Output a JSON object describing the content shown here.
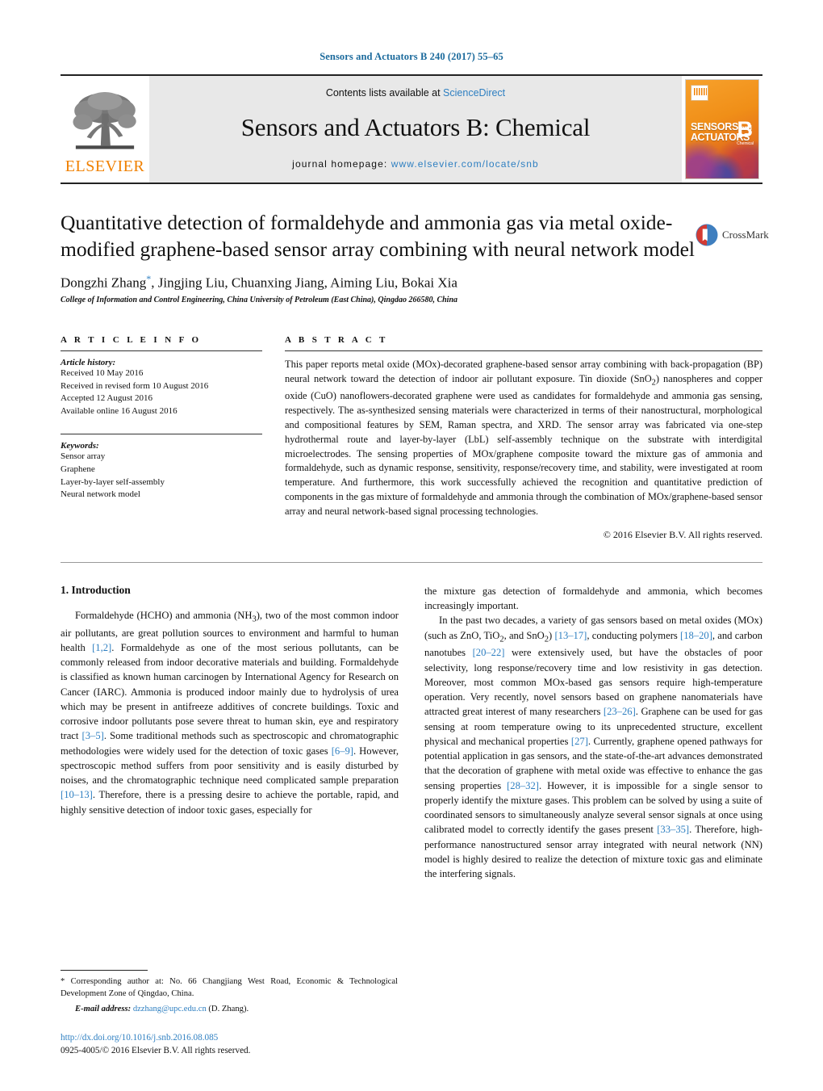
{
  "running_head": "Sensors and Actuators B 240 (2017) 55–65",
  "masthead": {
    "contents_prefix": "Contents lists available at ",
    "contents_link": "ScienceDirect",
    "journal_name": "Sensors and Actuators B: Chemical",
    "homepage_label": "journal homepage: ",
    "homepage_url": "www.elsevier.com/locate/snb",
    "publisher_wordmark": "ELSEVIER",
    "publisher_logo_icon": "elsevier-tree-icon",
    "cover": {
      "line1": "SENSORS",
      "line1_small": "and",
      "line2": "ACTUATORS",
      "letter": "B",
      "sublabel": "Chemical"
    }
  },
  "article": {
    "title": "Quantitative detection of formaldehyde and ammonia gas via metal oxide-modified graphene-based sensor array combining with neural network model",
    "authors": "Dongzhi Zhang",
    "authors_rest": ", Jingjing Liu, Chuanxing Jiang, Aiming Liu, Bokai Xia",
    "corresponding_marker": "*",
    "affiliation": "College of Information and Control Engineering, China University of Petroleum (East China), Qingdao 266580, China",
    "crossmark_label": "CrossMark",
    "crossmark_icon": "crossmark-icon"
  },
  "article_info": {
    "heading": "A R T I C L E   I N F O",
    "history_title": "Article history:",
    "history": [
      "Received 10 May 2016",
      "Received in revised form 10 August 2016",
      "Accepted 12 August 2016",
      "Available online 16 August 2016"
    ],
    "keywords_title": "Keywords:",
    "keywords": [
      "Sensor array",
      "Graphene",
      "Layer-by-layer self-assembly",
      "Neural network model"
    ]
  },
  "abstract": {
    "heading": "A B S T R A C T",
    "body": "This paper reports metal oxide (MOx)-decorated graphene-based sensor array combining with back-propagation (BP) neural network toward the detection of indoor air pollutant exposure. Tin dioxide (SnO2) nanospheres and copper oxide (CuO) nanoflowers-decorated graphene were used as candidates for formaldehyde and ammonia gas sensing, respectively. The as-synthesized sensing materials were characterized in terms of their nanostructural, morphological and compositional features by SEM, Raman spectra, and XRD. The sensor array was fabricated via one-step hydrothermal route and layer-by-layer (LbL) self-assembly technique on the substrate with interdigital microelectrodes. The sensing properties of MOx/graphene composite toward the mixture gas of ammonia and formaldehyde, such as dynamic response, sensitivity, response/recovery time, and stability, were investigated at room temperature. And furthermore, this work successfully achieved the recognition and quantitative prediction of components in the gas mixture of formaldehyde and ammonia through the combination of MOx/graphene-based sensor array and neural network-based signal processing technologies.",
    "copyright": "© 2016 Elsevier B.V. All rights reserved."
  },
  "body": {
    "section_heading": "1.  Introduction",
    "left_paragraphs": [
      "Formaldehyde (HCHO) and ammonia (NH3), two of the most common indoor air pollutants, are great pollution sources to environment and harmful to human health [1,2]. Formaldehyde as one of the most serious pollutants, can be commonly released from indoor decorative materials and building. Formaldehyde is classified as known human carcinogen by International Agency for Research on Cancer (IARC). Ammonia is produced indoor mainly due to hydrolysis of urea which may be present in antifreeze additives of concrete buildings. Toxic and corrosive indoor pollutants pose severe threat to human skin, eye and respiratory tract [3–5]. Some traditional methods such as spectroscopic and chromatographic methodologies were widely used for the detection of toxic gases [6–9]. However, spectroscopic method suffers from poor sensitivity and is easily disturbed by noises, and the chromatographic technique need complicated sample preparation [10–13]. Therefore, there is a pressing desire to achieve the portable, rapid, and highly sensitive detection of indoor toxic gases, especially for"
    ],
    "right_paragraphs": [
      "the mixture gas detection of formaldehyde and ammonia, which becomes increasingly important.",
      "In the past two decades, a variety of gas sensors based on metal oxides (MOx) (such as ZnO, TiO2, and SnO2) [13–17], conducting polymers [18–20], and carbon nanotubes [20–22] were extensively used, but have the obstacles of poor selectivity, long response/recovery time and low resistivity in gas detection. Moreover, most common MOx-based gas sensors require high-temperature operation. Very recently, novel sensors based on graphene nanomaterials have attracted great interest of many researchers [23–26]. Graphene can be used for gas sensing at room temperature owing to its unprecedented structure, excellent physical and mechanical properties [27]. Currently, graphene opened pathways for potential application in gas sensors, and the state-of-the-art advances demonstrated that the decoration of graphene with metal oxide was effective to enhance the gas sensing properties [28–32]. However, it is impossible for a single sensor to properly identify the mixture gases. This problem can be solved by using a suite of coordinated sensors to simultaneously analyze several sensor signals at once using calibrated model to correctly identify the gases present [33–35]. Therefore, high-performance nanostructured sensor array integrated with neural network (NN) model is highly desired to realize the detection of mixture toxic gas and eliminate the interfering signals."
    ]
  },
  "footnote": {
    "corresponding": "* Corresponding author at: No. 66 Changjiang West Road, Economic & Technological Development Zone of Qingdao, China.",
    "email_label": "E-mail address:",
    "email": "dzzhang@upc.edu.cn",
    "email_owner": "(D. Zhang).",
    "doi": "http://dx.doi.org/10.1016/j.snb.2016.08.085",
    "issn": "0925-4005/© 2016 Elsevier B.V. All rights reserved."
  },
  "colors": {
    "link_blue": "#2e7fc1",
    "elsevier_orange": "#F08000",
    "masthead_gray": "#e8e8e8"
  }
}
